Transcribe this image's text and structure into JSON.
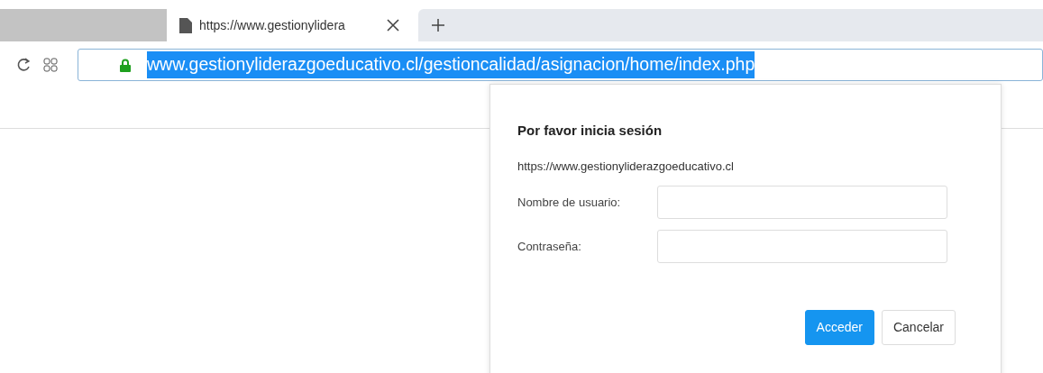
{
  "tabs": [
    {
      "selected": false
    },
    {
      "title": "https://www.gestionylidera",
      "selected": true
    }
  ],
  "address_bar": {
    "url": "www.gestionyliderazgoeducativo.cl/gestioncalidad/asignacion/home/index.php",
    "selected": true,
    "secure": true
  },
  "dialog": {
    "title": "Por favor inicia sesión",
    "origin": "https://www.gestionyliderazgoeducativo.cl",
    "fields": [
      {
        "label": "Nombre de usuario:"
      },
      {
        "label": "Contraseña:"
      }
    ],
    "buttons": [
      {
        "label": "Acceder",
        "kind": "primary"
      },
      {
        "label": "Cancelar",
        "kind": "secondary"
      }
    ]
  }
}
